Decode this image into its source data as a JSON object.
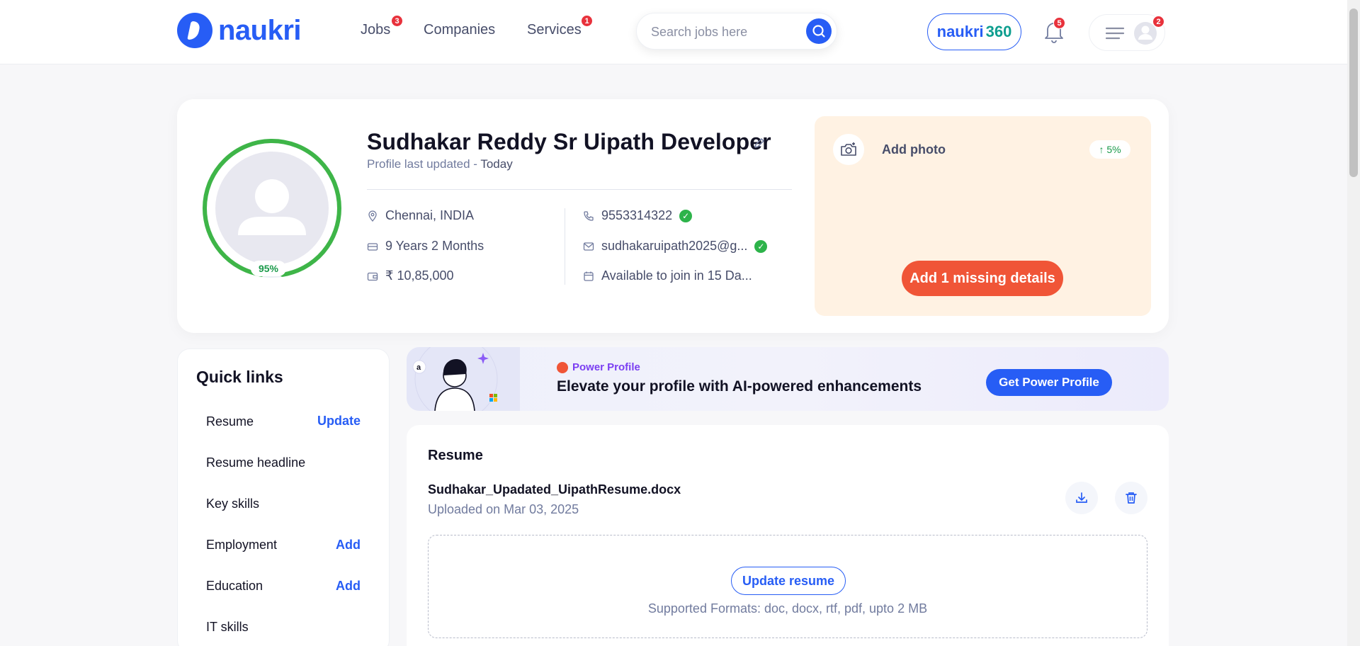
{
  "header": {
    "logo_text": "naukri",
    "nav": [
      {
        "label": "Jobs",
        "badge": "3"
      },
      {
        "label": "Companies"
      },
      {
        "label": "Services",
        "badge": "1"
      }
    ],
    "search_placeholder": "Search jobs here",
    "naukri360_a": "naukri",
    "naukri360_b": "360",
    "notifications_badge": "5",
    "menu_badge": "2"
  },
  "profile": {
    "name": "Sudhakar Reddy Sr Uipath Developer",
    "updated_prefix": "Profile last updated - ",
    "updated_value": "Today",
    "completion": "95%",
    "completion_value": 0.95,
    "location": "Chennai, INDIA",
    "experience": "9 Years 2 Months",
    "salary": "₹ 10,85,000",
    "phone": "9553314322",
    "email": "sudhakaruipath2025@g...",
    "availability": "Available to join in 15 Da..."
  },
  "pending": {
    "add_photo_label": "Add photo",
    "gain": "5%",
    "missing_button": "Add 1 missing details"
  },
  "quick_links": {
    "title": "Quick links",
    "items": [
      {
        "label": "Resume",
        "action": "Update"
      },
      {
        "label": "Resume headline",
        "action": ""
      },
      {
        "label": "Key skills",
        "action": ""
      },
      {
        "label": "Employment",
        "action": "Add"
      },
      {
        "label": "Education",
        "action": "Add"
      },
      {
        "label": "IT skills",
        "action": ""
      }
    ]
  },
  "power_profile": {
    "tag": "Power Profile",
    "title": "Elevate your profile with AI-powered enhancements",
    "button": "Get Power Profile"
  },
  "resume": {
    "title": "Resume",
    "file_name": "Sudhakar_Upadated_UipathResume.docx",
    "uploaded": "Uploaded on Mar 03, 2025",
    "update_button": "Update resume",
    "formats": "Supported Formats: doc, docx, rtf, pdf, upto 2 MB"
  },
  "colors": {
    "brand_blue": "#275df5",
    "success_green": "#2db34a",
    "cta_orange": "#f05537",
    "badge_red": "#e8323c"
  }
}
